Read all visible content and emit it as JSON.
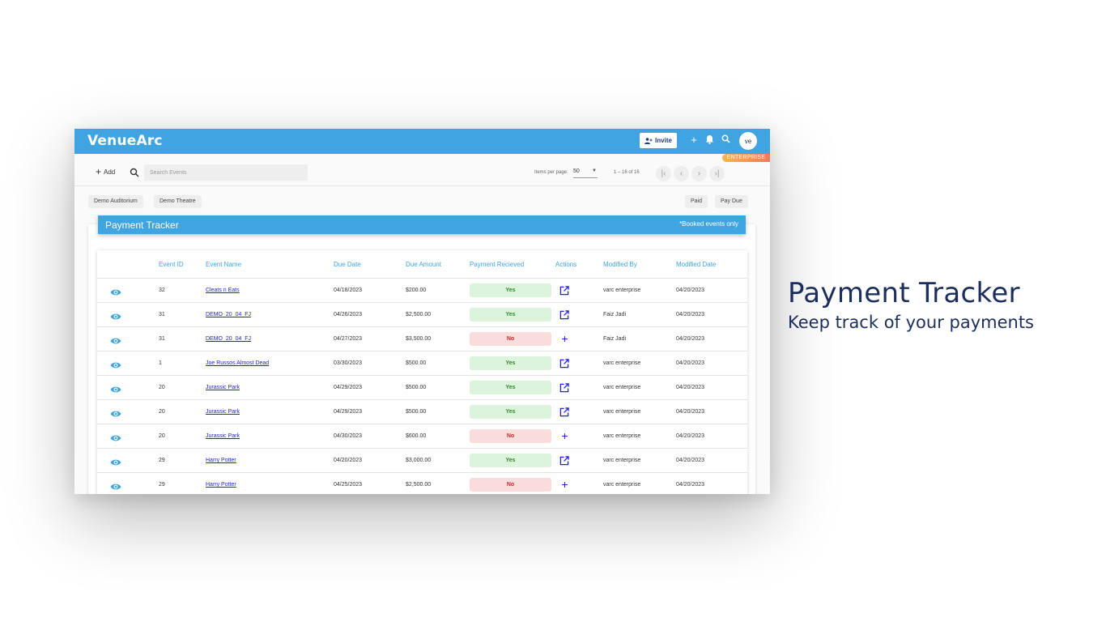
{
  "app": {
    "logo": "VenueArc",
    "invite_label": "Invite",
    "avatar_initials": "ve",
    "plan_badge": "ENTERPRISE",
    "accent_color": "#3fa4e0"
  },
  "toolbar": {
    "add_label": "Add",
    "search_placeholder": "Search Events",
    "items_per_page_label": "Items per page:",
    "items_per_page_value": "50",
    "range_label": "1 – 16 of 16"
  },
  "filters": {
    "venues": [
      "Demo Auditorium",
      "Demo Theatre"
    ],
    "status": [
      "Paid",
      "Pay Due"
    ]
  },
  "panel": {
    "title": "Payment Tracker",
    "note": "*Booked events only"
  },
  "table": {
    "columns": [
      "Event ID",
      "Event Name",
      "Due Date",
      "Due Amount",
      "Payment Recieved",
      "Actions",
      "Modified By",
      "Modified Date"
    ],
    "rows": [
      {
        "id": "32",
        "name": "Cleats n Eats",
        "due_date": "04/18/2023",
        "amount": "$200.00",
        "paid": "Yes",
        "action": "open-external-icon",
        "modified_by": "varc enterprise",
        "modified_date": "04/20/2023"
      },
      {
        "id": "31",
        "name": "DEMO_20_04_FJ",
        "due_date": "04/26/2023",
        "amount": "$2,500.00",
        "paid": "Yes",
        "action": "open-external-icon",
        "modified_by": "Faiz Jadi",
        "modified_date": "04/20/2023"
      },
      {
        "id": "31",
        "name": "DEMO_20_04_FJ",
        "due_date": "04/27/2023",
        "amount": "$3,500.00",
        "paid": "No",
        "action": "plus-icon",
        "modified_by": "Faiz Jadi",
        "modified_date": "04/20/2023"
      },
      {
        "id": "1",
        "name": "Joe Russos Almost Dead",
        "due_date": "03/30/2023",
        "amount": "$500.00",
        "paid": "Yes",
        "action": "open-external-icon",
        "modified_by": "varc enterprise",
        "modified_date": "04/20/2023"
      },
      {
        "id": "20",
        "name": "Jurassic Park",
        "due_date": "04/29/2023",
        "amount": "$500.00",
        "paid": "Yes",
        "action": "open-external-icon",
        "modified_by": "varc enterprise",
        "modified_date": "04/20/2023"
      },
      {
        "id": "20",
        "name": "Jurassic Park",
        "due_date": "04/29/2023",
        "amount": "$500.00",
        "paid": "Yes",
        "action": "open-external-icon",
        "modified_by": "varc enterprise",
        "modified_date": "04/20/2023"
      },
      {
        "id": "20",
        "name": "Jurassic Park",
        "due_date": "04/30/2023",
        "amount": "$600.00",
        "paid": "No",
        "action": "plus-icon",
        "modified_by": "varc enterprise",
        "modified_date": "04/20/2023"
      },
      {
        "id": "29",
        "name": "Harry Potter",
        "due_date": "04/20/2023",
        "amount": "$3,000.00",
        "paid": "Yes",
        "action": "open-external-icon",
        "modified_by": "varc enterprise",
        "modified_date": "04/20/2023"
      },
      {
        "id": "29",
        "name": "Harry Potter",
        "due_date": "04/25/2023",
        "amount": "$2,500.00",
        "paid": "No",
        "action": "plus-icon",
        "modified_by": "varc enterprise",
        "modified_date": "04/20/2023"
      }
    ]
  },
  "promo": {
    "title": "Payment Tracker",
    "subtitle": "Keep track of your payments"
  }
}
